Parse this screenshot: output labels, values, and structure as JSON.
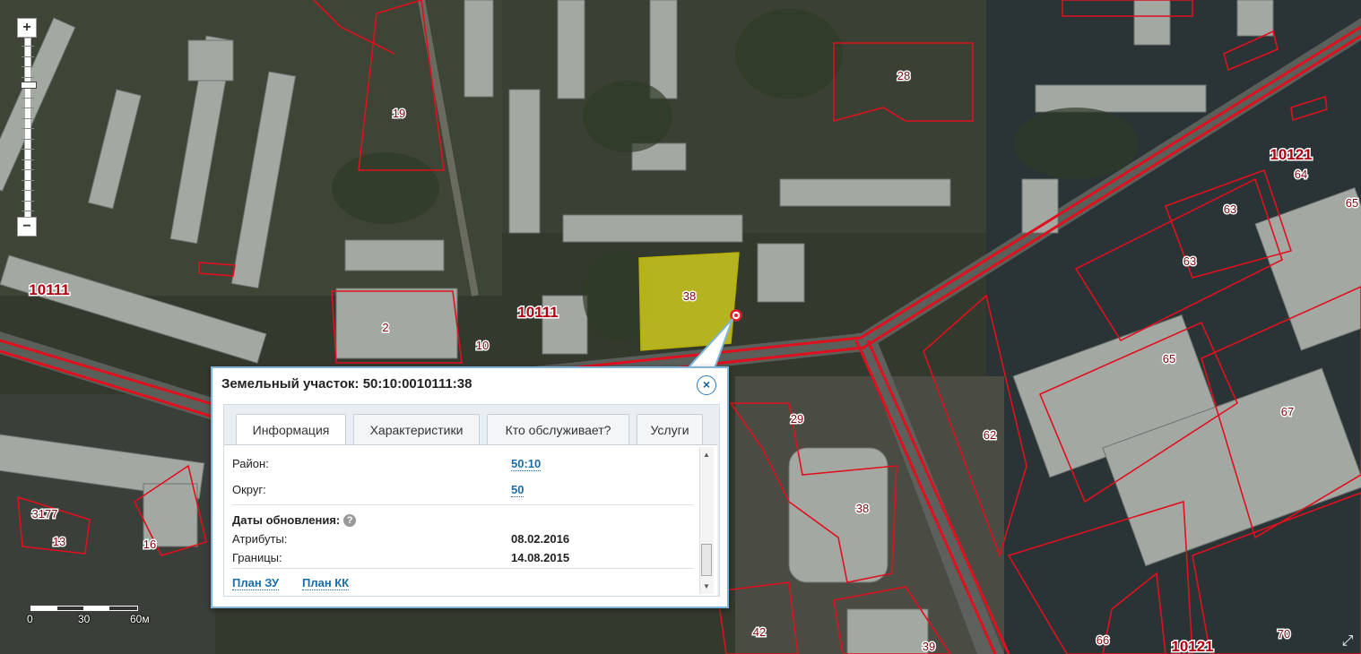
{
  "map": {
    "quarter_labels": [
      "10111",
      "10111",
      "10121",
      "10121"
    ],
    "parcel_labels": [
      "19",
      "28",
      "2",
      "13",
      "3177",
      "16",
      "29",
      "38",
      "42",
      "39",
      "62",
      "63",
      "63",
      "64",
      "65",
      "65",
      "67",
      "66",
      "70",
      "10"
    ],
    "selected_parcel_label": "38",
    "colors": {
      "boundary": "#e0101e",
      "selected_fill": "#d6d21c",
      "marker": "#e21c2c"
    }
  },
  "zoom": {
    "plus_label": "+",
    "minus_label": "−",
    "level_fraction": 0.24
  },
  "scale": {
    "labels": [
      "0",
      "30",
      "60м"
    ]
  },
  "popup": {
    "title": "Земельный участок: 50:10:0010111:38",
    "close_label": "×",
    "tabs": [
      {
        "label": "Информация",
        "active": true
      },
      {
        "label": "Характеристики",
        "active": false
      },
      {
        "label": "Кто обслуживает?",
        "active": false
      },
      {
        "label": "Услуги",
        "active": false
      }
    ],
    "info": {
      "district_label": "Район:",
      "district_value": "50:10",
      "okrug_label": "Округ:",
      "okrug_value": "50",
      "dates_heading": "Даты обновления:",
      "help_label": "?",
      "attributes_label": "Атрибуты:",
      "attributes_value": "08.02.2016",
      "borders_label": "Границы:",
      "borders_value": "14.08.2015",
      "plan_zu_link": "План ЗУ",
      "plan_kk_link": "План КК"
    }
  }
}
